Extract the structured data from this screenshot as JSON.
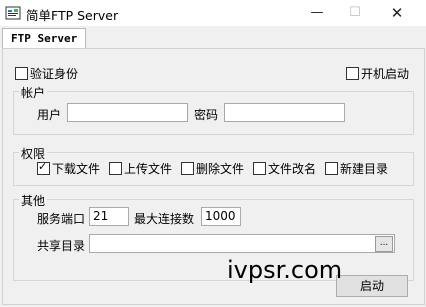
{
  "window": {
    "title": "简单FTP Server",
    "min_glyph": "—",
    "max_glyph": "☐",
    "close_glyph": "✕"
  },
  "tab": {
    "label": "FTP Server"
  },
  "options": {
    "verify_identity": {
      "label": "验证身份",
      "checked": false
    },
    "startup": {
      "label": "开机启动",
      "checked": false
    }
  },
  "account": {
    "legend": "帐户",
    "user_label": "用户",
    "user_value": "",
    "password_label": "密码",
    "password_value": ""
  },
  "permissions": {
    "legend": "权限",
    "items": [
      {
        "label": "下载文件",
        "checked": true
      },
      {
        "label": "上传文件",
        "checked": false
      },
      {
        "label": "删除文件",
        "checked": false
      },
      {
        "label": "文件改名",
        "checked": false
      },
      {
        "label": "新建目录",
        "checked": false
      }
    ]
  },
  "other": {
    "legend": "其他",
    "port_label": "服务端口",
    "port_value": "21",
    "maxconn_label": "最大连接数",
    "maxconn_value": "1000",
    "shared_dir_label": "共享目录",
    "shared_dir_value": "",
    "browse_label": "..."
  },
  "start_button": {
    "label": "启动"
  },
  "watermark": {
    "text": "ivpsr.com"
  }
}
